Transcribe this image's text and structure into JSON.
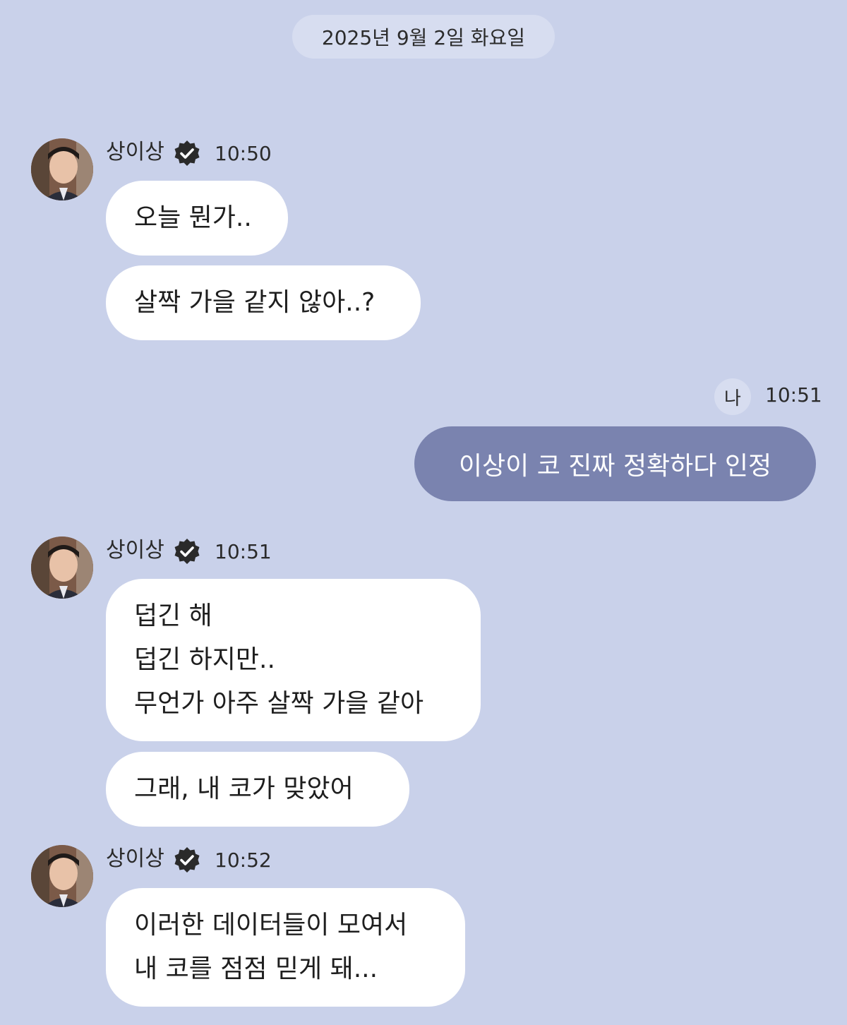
{
  "date_divider": "2025년 9월 2일 화요일",
  "colors": {
    "background": "#c9d1ea",
    "incoming_bubble": "#ffffff",
    "outgoing_bubble": "#7a83af",
    "pill": "#d7ddf0"
  },
  "groups": [
    {
      "sender": "상이상",
      "time": "10:50",
      "messages": [
        {
          "lines": [
            "오늘 뭔가.."
          ]
        },
        {
          "lines": [
            "살짝 가을 같지 않아..?"
          ]
        }
      ]
    },
    {
      "sender": "상이상",
      "time": "10:51",
      "messages": [
        {
          "lines": [
            "덥긴 해",
            "덥긴 하지만..",
            "무언가 아주 살짝 가을 같아"
          ]
        },
        {
          "lines": [
            "그래, 내 코가 맞았어"
          ]
        }
      ]
    },
    {
      "sender": "상이상",
      "time": "10:52",
      "messages": [
        {
          "lines": [
            "이러한 데이터들이 모여서",
            "내 코를 점점 믿게 돼..."
          ]
        }
      ]
    }
  ],
  "outgoing": {
    "tag": "나",
    "time": "10:51",
    "text": "이상이 코 진짜 정확하다 인정"
  },
  "icons": {
    "avatar": "profile-photo",
    "verified": "verified-badge-icon"
  }
}
